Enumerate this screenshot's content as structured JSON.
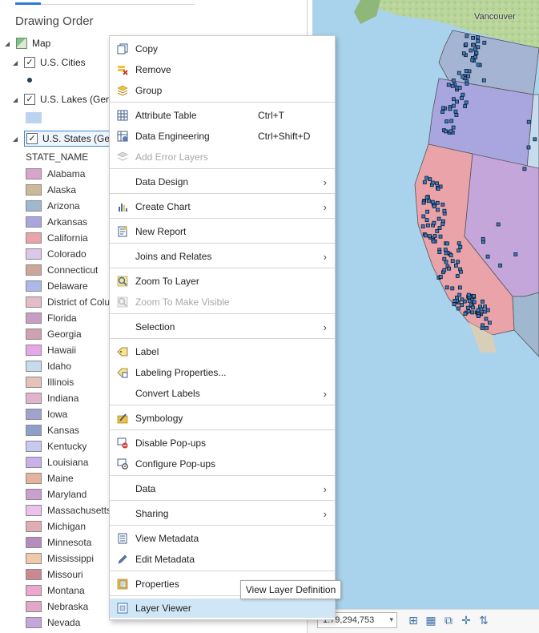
{
  "contents": {
    "title": "Drawing Order",
    "map_label": "Map",
    "layers": [
      {
        "label": "U.S. Cities"
      },
      {
        "label": "U.S. Lakes (Gene"
      },
      {
        "label": "U.S. States (Gene"
      }
    ],
    "field_header": "STATE_NAME",
    "states": [
      {
        "name": "Alabama",
        "color": "#d9a4c9"
      },
      {
        "name": "Alaska",
        "color": "#cdb99a"
      },
      {
        "name": "Arizona",
        "color": "#9fb8cf"
      },
      {
        "name": "Arkansas",
        "color": "#a9a5de"
      },
      {
        "name": "California",
        "color": "#eaa3a9"
      },
      {
        "name": "Colorado",
        "color": "#ddc6ea"
      },
      {
        "name": "Connecticut",
        "color": "#cfa69a"
      },
      {
        "name": "Delaware",
        "color": "#aab9ea"
      },
      {
        "name": "District of Colu",
        "color": "#e2bcc8"
      },
      {
        "name": "Florida",
        "color": "#c79cc5"
      },
      {
        "name": "Georgia",
        "color": "#cfa0b1"
      },
      {
        "name": "Hawaii",
        "color": "#e5a7e6"
      },
      {
        "name": "Idaho",
        "color": "#c7dbee"
      },
      {
        "name": "Illinois",
        "color": "#e5c3bb"
      },
      {
        "name": "Indiana",
        "color": "#e2b4cc"
      },
      {
        "name": "Iowa",
        "color": "#9fa3ce"
      },
      {
        "name": "Kansas",
        "color": "#8ea0c9"
      },
      {
        "name": "Kentucky",
        "color": "#c9c8ef"
      },
      {
        "name": "Louisiana",
        "color": "#c8b0ea"
      },
      {
        "name": "Maine",
        "color": "#e3b39c"
      },
      {
        "name": "Maryland",
        "color": "#c99fce"
      },
      {
        "name": "Massachusetts",
        "color": "#ecc2ec"
      },
      {
        "name": "Michigan",
        "color": "#e0adb5"
      },
      {
        "name": "Minnesota",
        "color": "#b68bbf"
      },
      {
        "name": "Mississippi",
        "color": "#efcaa8"
      },
      {
        "name": "Missouri",
        "color": "#c98892"
      },
      {
        "name": "Montana",
        "color": "#eaa9ca"
      },
      {
        "name": "Nebraska",
        "color": "#e2a6c6"
      },
      {
        "name": "Nevada",
        "color": "#c4a6da"
      }
    ]
  },
  "map": {
    "city_label": "Vancouver"
  },
  "menu": {
    "items": [
      {
        "label": "Copy",
        "icon": "copy-icon"
      },
      {
        "label": "Remove",
        "icon": "remove-icon"
      },
      {
        "label": "Group",
        "icon": "group-icon"
      },
      {
        "label": "Attribute Table",
        "icon": "table-icon",
        "shortcut": "Ctrl+T"
      },
      {
        "label": "Data Engineering",
        "icon": "data-engineering-icon",
        "shortcut": "Ctrl+Shift+D"
      },
      {
        "label": "Add Error Layers",
        "icon": "error-layers-icon"
      },
      {
        "label": "Data Design"
      },
      {
        "label": "Create Chart",
        "icon": "chart-icon"
      },
      {
        "label": "New Report",
        "icon": "report-icon"
      },
      {
        "label": "Joins and Relates"
      },
      {
        "label": "Zoom To Layer",
        "icon": "zoom-layer-icon"
      },
      {
        "label": "Zoom To Make Visible",
        "icon": "zoom-visible-icon"
      },
      {
        "label": "Selection"
      },
      {
        "label": "Label",
        "icon": "label-icon"
      },
      {
        "label": "Labeling Properties...",
        "icon": "labeling-properties-icon"
      },
      {
        "label": "Convert Labels"
      },
      {
        "label": "Symbology",
        "icon": "symbology-icon"
      },
      {
        "label": "Disable Pop-ups",
        "icon": "disable-popups-icon"
      },
      {
        "label": "Configure Pop-ups",
        "icon": "configure-popups-icon"
      },
      {
        "label": "Data"
      },
      {
        "label": "Sharing"
      },
      {
        "label": "View Metadata",
        "icon": "view-metadata-icon"
      },
      {
        "label": "Edit Metadata",
        "icon": "edit-metadata-icon"
      },
      {
        "label": "Properties",
        "icon": "properties-icon"
      },
      {
        "label": "Layer Viewer",
        "icon": "layer-viewer-icon"
      }
    ]
  },
  "tooltip": "View Layer Definition",
  "status": {
    "scale": "1:79,294,753"
  }
}
